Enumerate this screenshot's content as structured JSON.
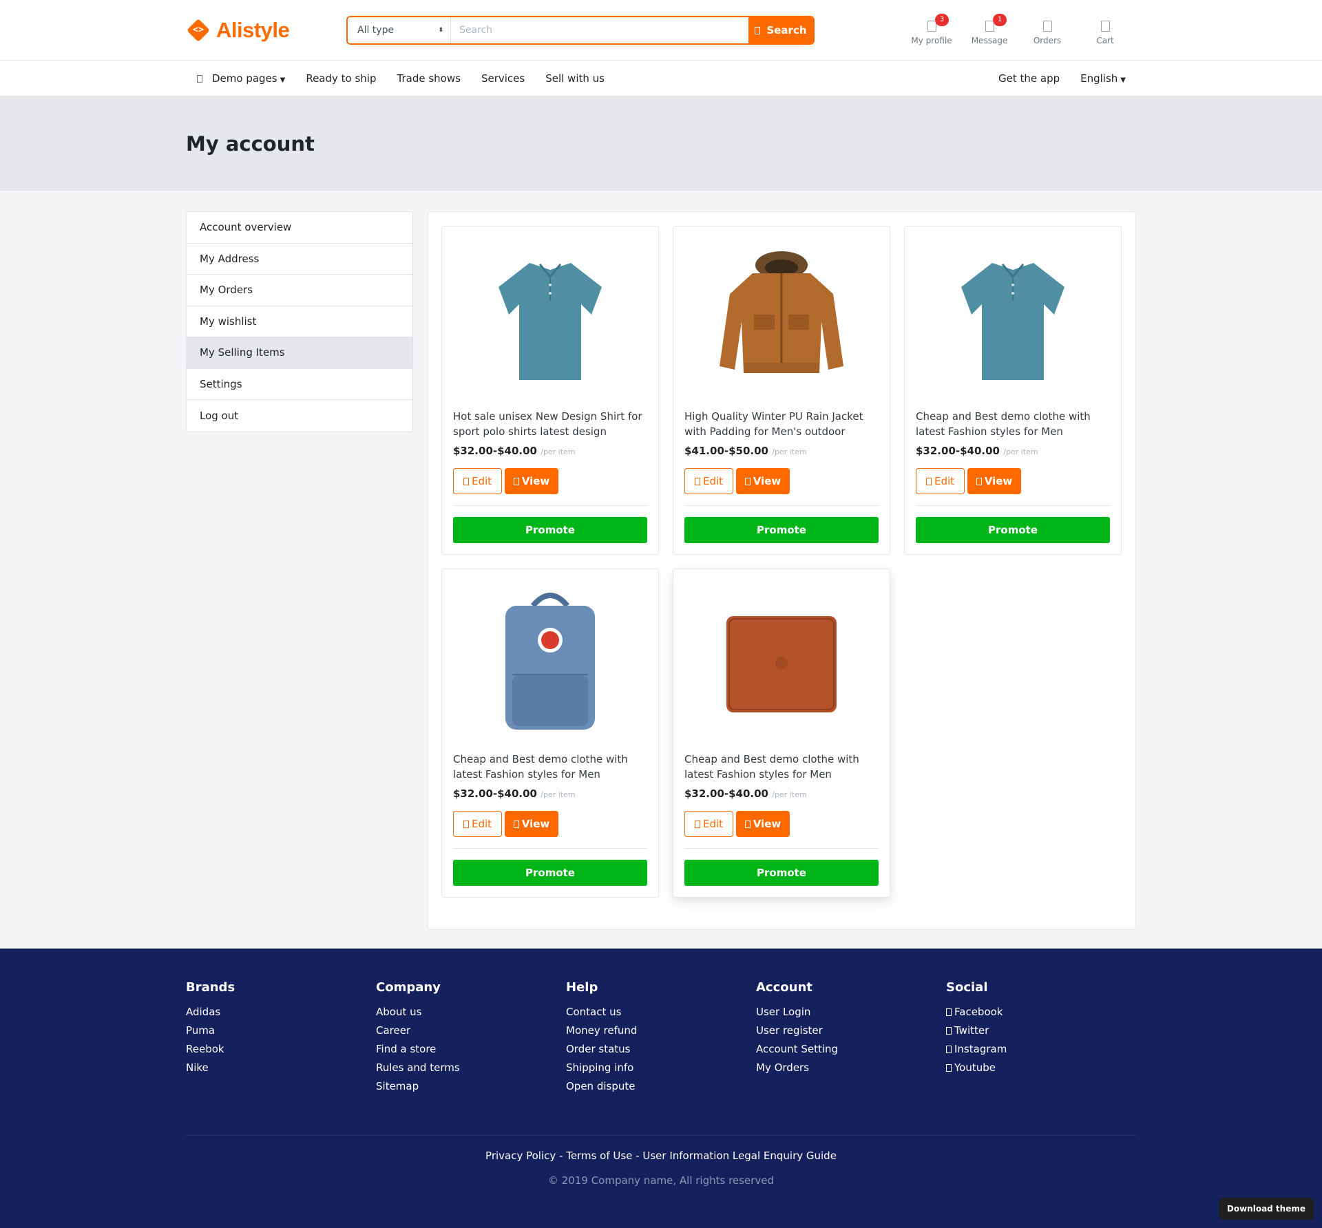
{
  "brand": {
    "name": "Alistyle",
    "color": "#ff6a00"
  },
  "search": {
    "type_selected": "All type",
    "placeholder": "Search",
    "button": "Search"
  },
  "header_icons": [
    {
      "label": "My profile",
      "badge": "3",
      "icon": "user-icon"
    },
    {
      "label": "Message",
      "badge": "1",
      "icon": "message-icon"
    },
    {
      "label": "Orders",
      "badge": "",
      "icon": "heart-icon"
    },
    {
      "label": "Cart",
      "badge": "",
      "icon": "cart-icon"
    }
  ],
  "nav": {
    "items": [
      "Demo pages",
      "Ready to ship",
      "Trade shows",
      "Services",
      "Sell with us"
    ],
    "right": [
      "Get the app",
      "English"
    ]
  },
  "page": {
    "title": "My account"
  },
  "sidebar": {
    "items": [
      "Account overview",
      "My Address",
      "My Orders",
      "My wishlist",
      "My Selling Items",
      "Settings",
      "Log out"
    ],
    "active": "My Selling Items"
  },
  "products": [
    {
      "title": "Hot sale unisex New Design Shirt for sport polo shirts latest design",
      "price": "$32.00-$40.00",
      "unit": "/per item",
      "image": "polo-shirt"
    },
    {
      "title": "High Quality Winter PU Rain Jacket with Padding for Men's outdoor",
      "price": "$41.00-$50.00",
      "unit": "/per item",
      "image": "winter-jacket"
    },
    {
      "title": "Cheap and Best demo clothe with latest Fashion styles for Men",
      "price": "$32.00-$40.00",
      "unit": "/per item",
      "image": "polo-shirt"
    },
    {
      "title": "Cheap and Best demo clothe with latest Fashion styles for Men",
      "price": "$32.00-$40.00",
      "unit": "/per item",
      "image": "backpack"
    },
    {
      "title": "Cheap and Best demo clothe with latest Fashion styles for Men",
      "price": "$32.00-$40.00",
      "unit": "/per item",
      "image": "laptop-sleeve"
    }
  ],
  "card_buttons": {
    "edit": "Edit",
    "view": "View",
    "promote": "Promote"
  },
  "colors": {
    "accent": "#ff6a00",
    "promote": "#00b517",
    "footer_bg": "#14215c"
  },
  "footer": {
    "columns": [
      {
        "title": "Brands",
        "links": [
          "Adidas",
          "Puma",
          "Reebok",
          "Nike"
        ]
      },
      {
        "title": "Company",
        "links": [
          "About us",
          "Career",
          "Find a store",
          "Rules and terms",
          "Sitemap"
        ]
      },
      {
        "title": "Help",
        "links": [
          "Contact us",
          "Money refund",
          "Order status",
          "Shipping info",
          "Open dispute"
        ]
      },
      {
        "title": "Account",
        "links": [
          "User Login",
          "User register",
          "Account Setting",
          "My Orders"
        ]
      },
      {
        "title": "Social",
        "links": [
          "Facebook",
          "Twitter",
          "Instagram",
          "Youtube"
        ]
      }
    ],
    "bottom_links": "Privacy Policy - Terms of Use - User Information Legal Enquiry Guide",
    "copyright": "© 2019 Company name, All rights reserved"
  },
  "download_button": "Download theme"
}
